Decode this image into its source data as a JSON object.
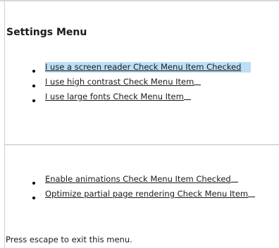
{
  "menu": {
    "title": "Settings Menu",
    "group1": [
      {
        "label": "I use a screen reader Check Menu Item Checked",
        "highlighted": true
      },
      {
        "label": "I use high contrast Check Menu Item",
        "highlighted": false
      },
      {
        "label": "I use large fonts Check Menu Item",
        "highlighted": false
      }
    ],
    "group2": [
      {
        "label": "Enable animations Check Menu Item Checked",
        "highlighted": false
      },
      {
        "label": "Optimize partial page rendering Check Menu Item",
        "highlighted": false
      }
    ]
  },
  "footer": {
    "hint": "Press escape to exit this menu."
  },
  "colors": {
    "highlight": "#bcdff5"
  }
}
